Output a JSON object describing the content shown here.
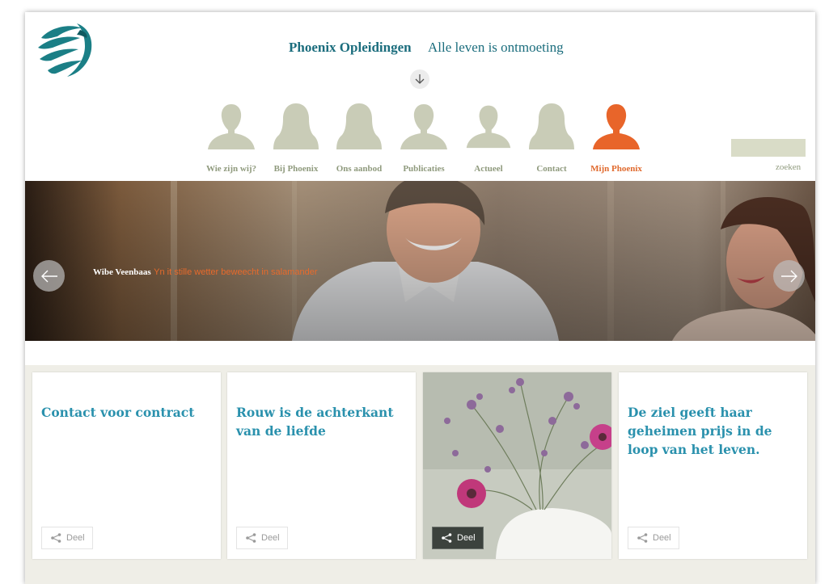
{
  "header": {
    "title": "Phoenix Opleidingen",
    "tagline": "Alle leven is ontmoeting"
  },
  "nav": {
    "items": [
      {
        "label": "Wie zijn wij?",
        "figure": "male"
      },
      {
        "label": "Bij Phoenix",
        "figure": "female"
      },
      {
        "label": "Ons aanbod",
        "figure": "female"
      },
      {
        "label": "Publicaties",
        "figure": "male"
      },
      {
        "label": "Actueel",
        "figure": "male"
      },
      {
        "label": "Contact",
        "figure": "female"
      },
      {
        "label": "Mijn Phoenix",
        "figure": "male",
        "active": true
      }
    ]
  },
  "search": {
    "label": "zoeken",
    "value": ""
  },
  "hero": {
    "name": "Wibe Veenbaas",
    "quote": "Yn it stille wetter beweecht in salamander"
  },
  "cards": [
    {
      "title": "Contact voor contract",
      "share_label": "Deel",
      "type": "text"
    },
    {
      "title": "Rouw is de achterkant van de liefde",
      "share_label": "Deel",
      "type": "text"
    },
    {
      "title": "",
      "share_label": "Deel",
      "type": "image"
    },
    {
      "title": "De ziel geeft haar geheimen prijs in de loop van het leven.",
      "share_label": "Deel",
      "type": "text"
    }
  ],
  "colors": {
    "brand_teal": "#1b6d7d",
    "card_title_blue": "#2a91ad",
    "accent_orange": "#e06a2e",
    "nav_gray_green": "#c9ccb7"
  },
  "icons": {
    "logo": "phoenix-logo",
    "scroll": "arrow-down-icon",
    "prev": "arrow-left-icon",
    "next": "arrow-right-icon",
    "share": "share-icon"
  }
}
